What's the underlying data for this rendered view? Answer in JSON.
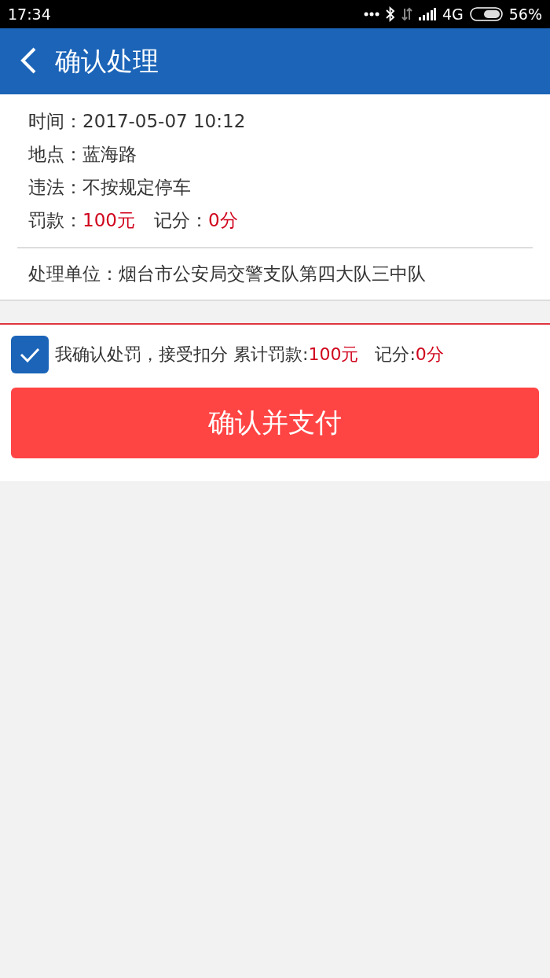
{
  "status_bar": {
    "time": "17:34",
    "network": "4G",
    "battery": "56%"
  },
  "header": {
    "title": "确认处理"
  },
  "details": [
    {
      "kind": "plain",
      "label": "时间：",
      "value": "2017-05-07 10:12"
    },
    {
      "kind": "plain",
      "label": "地点：",
      "value": "蓝海路"
    },
    {
      "kind": "plain",
      "label": "违法：",
      "value": "不按规定停车"
    },
    {
      "kind": "pair",
      "label": "罚款：",
      "value": "100元",
      "label2": "记分：",
      "value2": "0分"
    }
  ],
  "unit": {
    "label": "处理单位：",
    "value": "烟台市公安局交警支队第四大队三中队"
  },
  "confirm": {
    "checked": true,
    "segments": [
      {
        "text": "我确认处罚，接受扣分 累计罚款:",
        "emphasis": false
      },
      {
        "text": "100元",
        "emphasis": true
      },
      {
        "text": "   记分:",
        "emphasis": false
      },
      {
        "text": "0分",
        "emphasis": true
      }
    ]
  },
  "pay_button": {
    "label": "确认并支付"
  }
}
